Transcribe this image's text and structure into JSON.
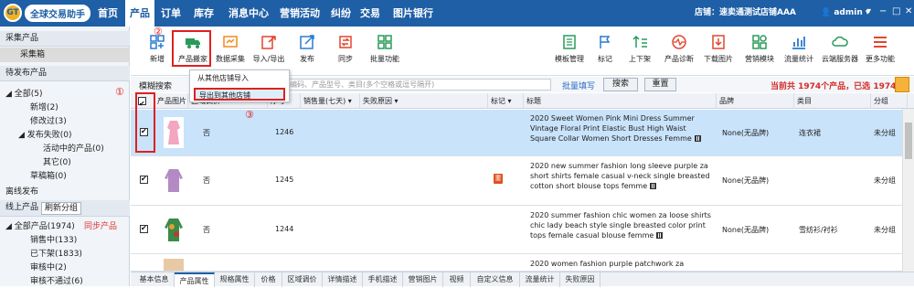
{
  "app": {
    "name": "全球交易助手"
  },
  "nav": {
    "items": [
      "首页",
      "产品",
      "订单",
      "库存",
      "消息中心",
      "营销活动",
      "纠纷",
      "交易",
      "图片银行"
    ],
    "active_index": 1,
    "store_label": "店铺：速卖通测试店铺AAA",
    "user": "admin"
  },
  "sidebar": {
    "section1": "采集产品",
    "section1_item": "采集箱",
    "section2": "待发布产品",
    "all_label": "全部(5)",
    "items": [
      "新增(2)",
      "修改过(3)"
    ],
    "failed": "发布失败(0)",
    "failed_items": [
      "活动中的产品(0)",
      "其它(0)"
    ],
    "draft": "草稿箱(0)",
    "offline": "离线发布",
    "section3": "线上产品",
    "refresh_btn": "刷新分组",
    "online_all": "全部产品(1974)",
    "sync_link": "同步产品",
    "online_items": [
      "销售中(133)",
      "已下架(1833)",
      "审核中(2)",
      "审核不通过(6)"
    ]
  },
  "toolbar": {
    "left": [
      "新增",
      "产品搬家",
      "数据采集",
      "导入/导出",
      "发布",
      "同步",
      "批量功能"
    ],
    "right": [
      "模板管理",
      "标记",
      "上下架",
      "产品诊断",
      "下载图片",
      "营销模块",
      "流量统计",
      "云端服务器",
      "更多功能"
    ]
  },
  "dropdown": {
    "items": [
      "从其他店铺导入",
      "导出到其他店铺"
    ]
  },
  "search": {
    "label": "模糊搜索",
    "placeholder": "标题、商家编码、产品型号、类目(多个空格或逗号隔开)",
    "fill_link": "批量填写",
    "search_btn": "搜索",
    "reset_btn": "重置",
    "count_text": "当前共 1974个产品，已选 1974个"
  },
  "table": {
    "columns": [
      "产品图片",
      "区域调价",
      "序号",
      "销售量(七天)",
      "失败原因",
      "标记",
      "标题",
      "品牌",
      "类目",
      "分组"
    ],
    "rows": [
      {
        "price_adjust": "否",
        "seq": "1246",
        "title": "2020 Sweet Women Pink Mini Dress Summer Vintage Floral Print Elastic Bust High Waist Square Collar Women Short Dresses Femme",
        "brand": "None(无品牌)",
        "category": "连衣裙",
        "group": "未分组",
        "flag": "",
        "selected": true,
        "thumb_color": "#f2a6c0"
      },
      {
        "price_adjust": "否",
        "seq": "1245",
        "title": "2020 new summer fashion long sleeve purple za short shirts female casual v-neck single breasted cotton short blouse tops femme",
        "brand": "None(无品牌)",
        "category": "",
        "group": "未分组",
        "flag": "重",
        "selected": true,
        "thumb_color": "#b48ac4"
      },
      {
        "price_adjust": "否",
        "seq": "1244",
        "title": "2020 summer fashion chic women za loose shirts chic lady beach style single breasted color print tops female casual blouse femme",
        "brand": "None(无品牌)",
        "category": "雪纺衫/衬衫",
        "group": "未分组",
        "flag": "",
        "selected": true,
        "thumb_color": "#3a8a4a"
      },
      {
        "price_adjust": "",
        "seq": "",
        "title": "2020 women fashion purple patchwork za",
        "brand": "",
        "category": "",
        "group": "",
        "flag": "",
        "selected": false,
        "thumb_color": "#e8c9a6"
      }
    ]
  },
  "bottom_tabs": [
    "基本信息",
    "产品属性",
    "规格属性",
    "价格",
    "区域调价",
    "详情描述",
    "手机描述",
    "营销图片",
    "视频",
    "自定义信息",
    "流量统计",
    "失败原因"
  ],
  "bottom_tab_active": 1,
  "annotations": [
    "①",
    "②",
    "③"
  ],
  "colors": {
    "nav": "#1f5fa6",
    "highlight": "#e02020",
    "selected_row": "#c9e3fb",
    "link": "#2a6ac9"
  }
}
